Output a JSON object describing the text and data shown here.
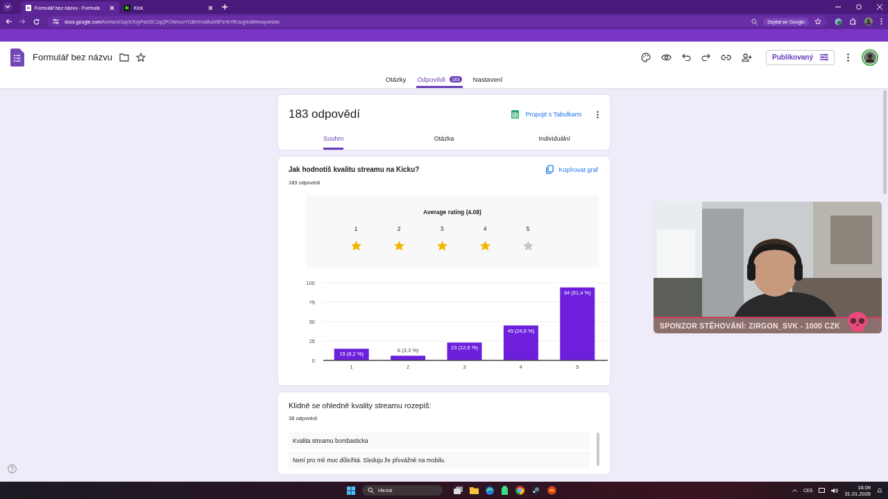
{
  "browser": {
    "tabs": [
      {
        "title": "Formulář bez názvu - Formulá",
        "selected": true
      },
      {
        "title": "Kick",
        "selected": false
      }
    ],
    "url_host": "docs.google.com",
    "url_path": "/forms/d/1spXrfUyPaSSC1qQPOWvooYGBHVva9u0r8FsYeYlKszg/edit#responses",
    "ask_google": "Zeptat se Googlu"
  },
  "form": {
    "title": "Formulář bez názvu",
    "publish_button": "Publikovaný",
    "tabs": [
      {
        "label": "Otázky",
        "selected": false
      },
      {
        "label": "Odpovědi",
        "badge": "183",
        "selected": true
      },
      {
        "label": "Nastavení",
        "selected": false
      }
    ]
  },
  "summary": {
    "title": "183 odpovědí",
    "link_sheets": "Propojit s Tabulkami",
    "tabs": [
      {
        "label": "Souhrn",
        "selected": true
      },
      {
        "label": "Otázka",
        "selected": false
      },
      {
        "label": "Individuální",
        "selected": false
      }
    ]
  },
  "questions": [
    {
      "kind": "rating",
      "title": "Jak hodnotíš kvalitu streamu na Kicku?",
      "count": "183 odpovědí",
      "copy": "Kopírovat graf",
      "rating": {
        "title": "Average rating (4.08)",
        "labels": [
          "1",
          "2",
          "3",
          "4",
          "5"
        ],
        "stars": 4
      },
      "chart_data": {
        "type": "bar",
        "categories": [
          "1",
          "2",
          "3",
          "4",
          "5"
        ],
        "values": [
          15,
          6,
          23,
          45,
          94
        ],
        "ylim": [
          0,
          100
        ],
        "grid": true,
        "yticks": [
          0,
          25,
          50,
          75,
          100
        ],
        "value_labels": [
          "15 (8,2 %)",
          "6 (3,3 %)",
          "23 (12,6 %)",
          "45 (24,6 %)",
          "94 (51,4 %)"
        ]
      }
    },
    {
      "kind": "text",
      "title": "Klidně se ohledně kvality streamu rozepiš:",
      "count": "38 odpovědí",
      "answers": [
        "Kvalita streamu bombasticka",
        "Není pro mě moc důležitá. Sleduju že převážně na mobilu."
      ]
    }
  ],
  "stream_overlay": {
    "kind": "picture",
    "banner": "SPONZOR STĚHOVÁNÍ: ZIRGON_SVK - 1000 CZK"
  },
  "taskbar": {
    "search": "Hledat",
    "language": "CES",
    "time": "16:09",
    "date": "31.01.2026"
  }
}
